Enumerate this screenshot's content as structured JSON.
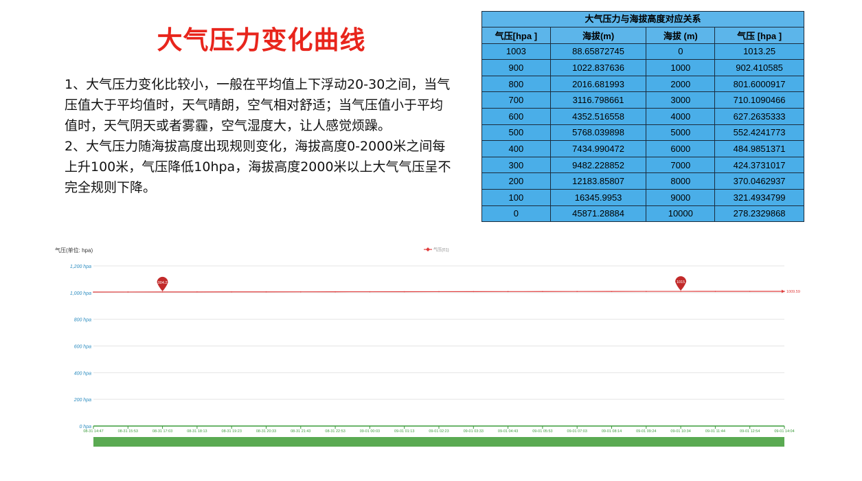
{
  "title": "大气压力变化曲线",
  "description": [
    "1、大气压力变化比较小，一般在平均值上下浮动20-30之间，当气压值大于平均值时，天气晴朗，空气相对舒适；当气压值小于平均值时，天气阴天或者雾霾，空气湿度大，让人感觉烦躁。",
    "2、大气压力随海拔高度出现规则变化，海拔高度0-2000米之间每上升100米，气压降低10hpa，海拔高度2000米以上大气气压呈不完全规则下降。"
  ],
  "table": {
    "caption": "大气压力与海拔高度对应关系",
    "headers": [
      "气压[hpa ]",
      "海拔(m)",
      "海拔 (m)",
      "气压 [hpa ]"
    ],
    "rows": [
      [
        "1003",
        "88.65872745",
        "0",
        "1013.25"
      ],
      [
        "900",
        "1022.837636",
        "1000",
        "902.410585"
      ],
      [
        "800",
        "2016.681993",
        "2000",
        "801.6000917"
      ],
      [
        "700",
        "3116.798661",
        "3000",
        "710.1090466"
      ],
      [
        "600",
        "4352.516558",
        "4000",
        "627.2635333"
      ],
      [
        "500",
        "5768.039898",
        "5000",
        "552.4241773"
      ],
      [
        "400",
        "7434.990472",
        "6000",
        "484.9851371"
      ],
      [
        "300",
        "9482.228852",
        "7000",
        "424.3731017"
      ],
      [
        "200",
        "12183.85807",
        "8000",
        "370.0462937"
      ],
      [
        "100",
        "16345.9953",
        "9000",
        "321.4934799"
      ],
      [
        "0",
        "45871.28884",
        "10000",
        "278.2329868"
      ]
    ]
  },
  "chart_data": {
    "type": "line",
    "ylabel": "气压(单位: hpa)",
    "ylim": [
      0,
      1200
    ],
    "yticks": [
      "0 hpa",
      "200 hpa",
      "400 hpa",
      "600 hpa",
      "800 hpa",
      "1,000 hpa",
      "1,200 hpa"
    ],
    "categories": [
      "08-31 14:47",
      "08-31 15:53",
      "08-31 17:03",
      "08-31 18:13",
      "08-31 19:23",
      "08-31 20:33",
      "08-31 21:43",
      "08-31 22:53",
      "09-01 00:03",
      "09-01 01:13",
      "09-01 02:23",
      "09-01 03:33",
      "09-01 04:43",
      "09-01 05:53",
      "09-01 07:03",
      "09-01 08:14",
      "09-01 09:24",
      "09-01 10:34",
      "09-01 11:44",
      "09-01 12:54",
      "09-01 14:04"
    ],
    "series": [
      {
        "name": "气压(01)",
        "values": [
          1004.21,
          1004.5,
          1004.8,
          1005.1,
          1005.4,
          1005.7,
          1006.0,
          1006.3,
          1006.6,
          1006.9,
          1007.2,
          1007.5,
          1007.8,
          1008.1,
          1008.4,
          1008.7,
          1009.0,
          1009.2,
          1009.3,
          1009.5,
          1009.59
        ]
      }
    ],
    "annotations": [
      {
        "label": "1004.21",
        "type": "min",
        "index": 2
      },
      {
        "label": "1015",
        "type": "max",
        "index": 17
      },
      {
        "label": "1009.59",
        "type": "last"
      }
    ],
    "colors": {
      "line": "#e03c3c",
      "xaxis": "#3a9b3a",
      "ytick": "#2a8bbf",
      "band": "#5aaa52"
    },
    "grid": true,
    "legend": "top-center"
  }
}
